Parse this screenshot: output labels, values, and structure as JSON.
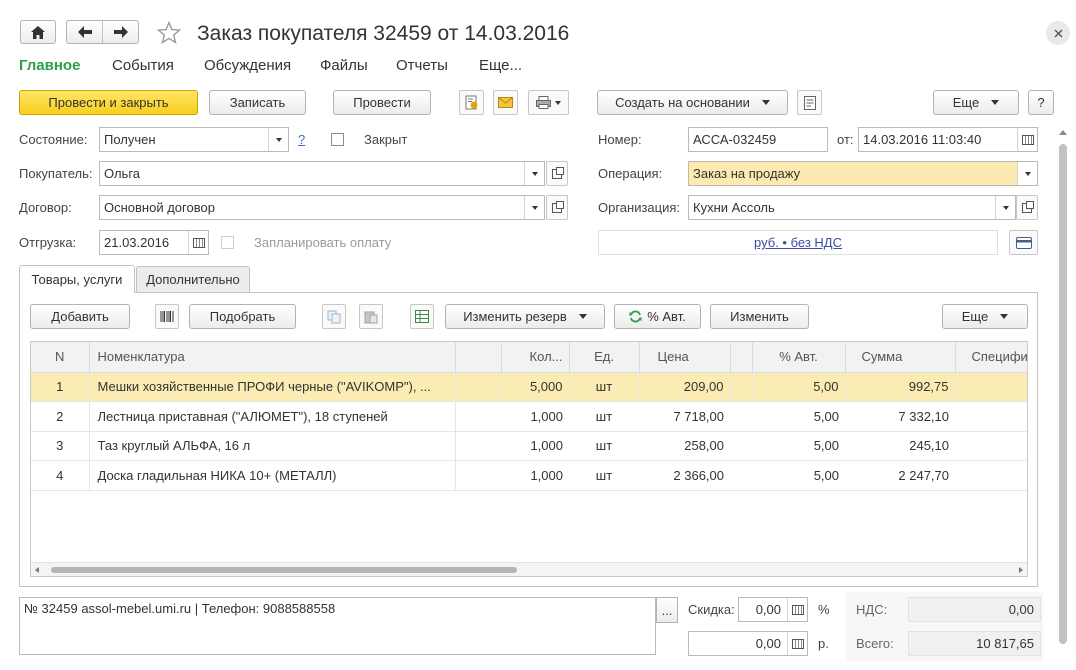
{
  "window": {
    "title": "Заказ покупателя 32459 от 14.03.2016"
  },
  "nav_tabs": [
    "Главное",
    "События",
    "Обсуждения",
    "Файлы",
    "Отчеты",
    "Еще..."
  ],
  "toolbar": {
    "post_close": "Провести и закрыть",
    "save": "Записать",
    "post": "Провести",
    "create_based": "Создать на основании",
    "more": "Еще",
    "help": "?"
  },
  "form": {
    "state_label": "Состояние:",
    "state_value": "Получен",
    "state_help": "?",
    "closed_label": "Закрыт",
    "buyer_label": "Покупатель:",
    "buyer_value": "Ольга",
    "contract_label": "Договор:",
    "contract_value": "Основной договор",
    "shipment_label": "Отгрузка:",
    "shipment_value": "21.03.2016",
    "plan_payment_label": "Запланировать оплату",
    "number_label": "Номер:",
    "number_value": "АССА-032459",
    "from_label": "от:",
    "date_value": "14.03.2016 11:03:40",
    "operation_label": "Операция:",
    "operation_value": "Заказ на продажу",
    "org_label": "Организация:",
    "org_value": "Кухни Ассоль",
    "currency_link": "руб. • без НДС"
  },
  "doc_tabs": [
    "Товары, услуги",
    "Дополнительно"
  ],
  "table_toolbar": {
    "add": "Добавить",
    "pick": "Подобрать",
    "change_reserve": "Изменить резерв",
    "auto_percent": "% Авт.",
    "change": "Изменить",
    "more": "Еще"
  },
  "table": {
    "columns": [
      "N",
      "Номенклатура",
      "",
      "Кол...",
      "Ед.",
      "Цена",
      "",
      "% Авт.",
      "Сумма",
      "Спецификац"
    ],
    "rows": [
      {
        "n": "1",
        "name": "Мешки хозяйственные ПРОФИ черные (\"AVIKOMP\"), ...",
        "qty": "5,000",
        "unit": "шт",
        "price": "209,00",
        "auto": "5,00",
        "sum": "992,75"
      },
      {
        "n": "2",
        "name": "Лестница приставная (\"АЛЮМЕТ\"), 18 ступеней",
        "qty": "1,000",
        "unit": "шт",
        "price": "7 718,00",
        "auto": "5,00",
        "sum": "7 332,10"
      },
      {
        "n": "3",
        "name": "Таз круглый АЛЬФА, 16 л",
        "qty": "1,000",
        "unit": "шт",
        "price": "258,00",
        "auto": "5,00",
        "sum": "245,10"
      },
      {
        "n": "4",
        "name": "Доска гладильная  НИКА 10+ (МЕТАЛЛ)",
        "qty": "1,000",
        "unit": "шт",
        "price": "2 366,00",
        "auto": "5,00",
        "sum": "2 247,70"
      }
    ]
  },
  "footer": {
    "comment": "№ 32459 assol-mebel.umi.ru | Телефон: 9088588558",
    "comment_btn": "...",
    "discount_label": "Скидка:",
    "discount_percent": "0,00",
    "percent_sign": "%",
    "discount_amount": "0,00",
    "rub_sign": "р.",
    "vat_label": "НДС:",
    "vat_value": "0,00",
    "total_label": "Всего:",
    "total_value": "10 817,65"
  }
}
